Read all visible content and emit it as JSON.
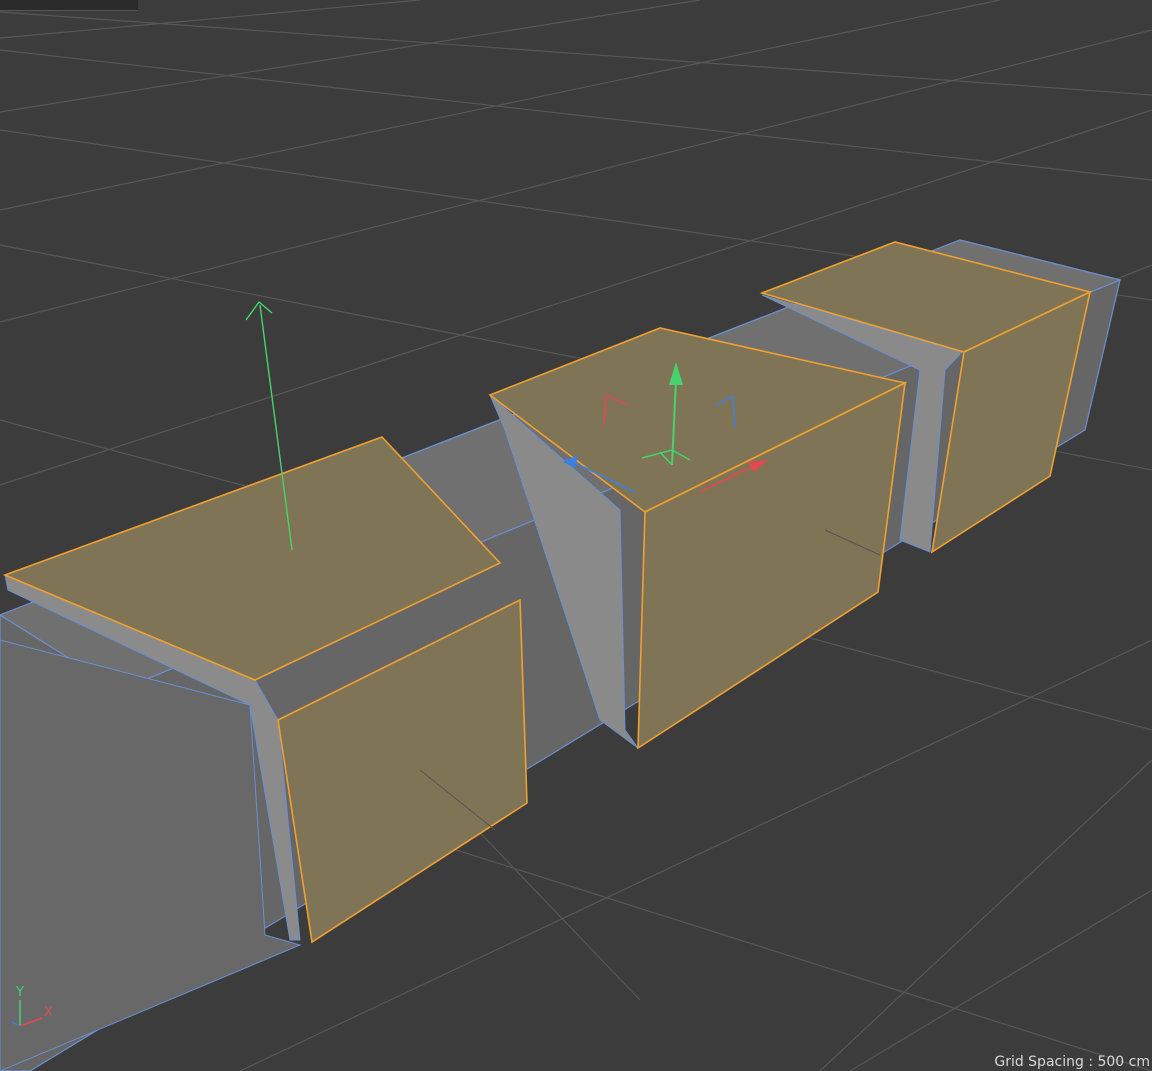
{
  "viewport": {
    "grid_spacing_label": "Grid Spacing : 500 cm"
  },
  "axis_indicator": {
    "y_label": "Y",
    "x_label": "X"
  },
  "colors": {
    "background": "#3c3c3c",
    "grid_line": "#555555",
    "mesh_face": "#6f6f6f",
    "mesh_face_light": "#9a9a9a",
    "selected_face": "#7f7455",
    "selection_outline": "#f0a030",
    "mesh_edge": "#6b8fd0",
    "axis_x": "#e0494f",
    "axis_y": "#47d36c",
    "axis_z": "#3f7fe0"
  },
  "icons": {
    "move_gizmo": "move-gizmo-icon",
    "normal_arrow": "normal-arrow-icon",
    "world_axis": "world-axis-icon"
  }
}
